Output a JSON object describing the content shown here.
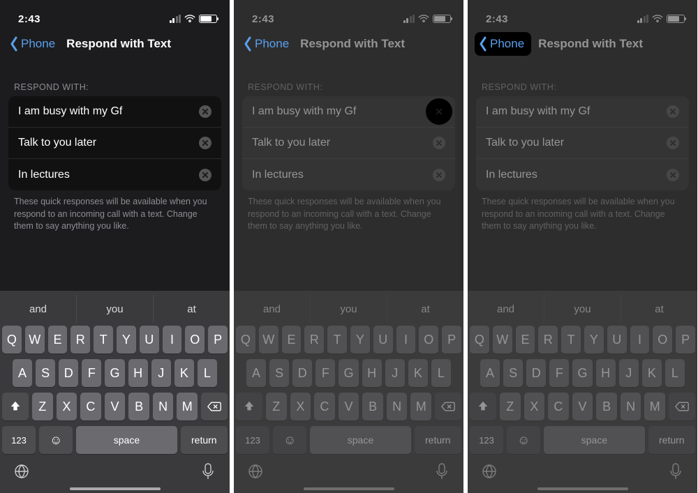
{
  "status": {
    "time": "2:43"
  },
  "nav": {
    "back_label": "Phone",
    "title": "Respond with Text"
  },
  "section_label": "RESPOND WITH:",
  "responses": [
    "I am busy with my Gf",
    "Talk to you later",
    "In lectures"
  ],
  "footer": "These quick responses will be available when you respond to an incoming call with a text. Change them to say anything you like.",
  "suggestions": [
    "and",
    "you",
    "at"
  ],
  "keys": {
    "row1": [
      "Q",
      "W",
      "E",
      "R",
      "T",
      "Y",
      "U",
      "I",
      "O",
      "P"
    ],
    "row2": [
      "A",
      "S",
      "D",
      "F",
      "G",
      "H",
      "J",
      "K",
      "L"
    ],
    "row3": [
      "Z",
      "X",
      "C",
      "V",
      "B",
      "N",
      "M"
    ],
    "num": "123",
    "space": "space",
    "return": "return"
  }
}
